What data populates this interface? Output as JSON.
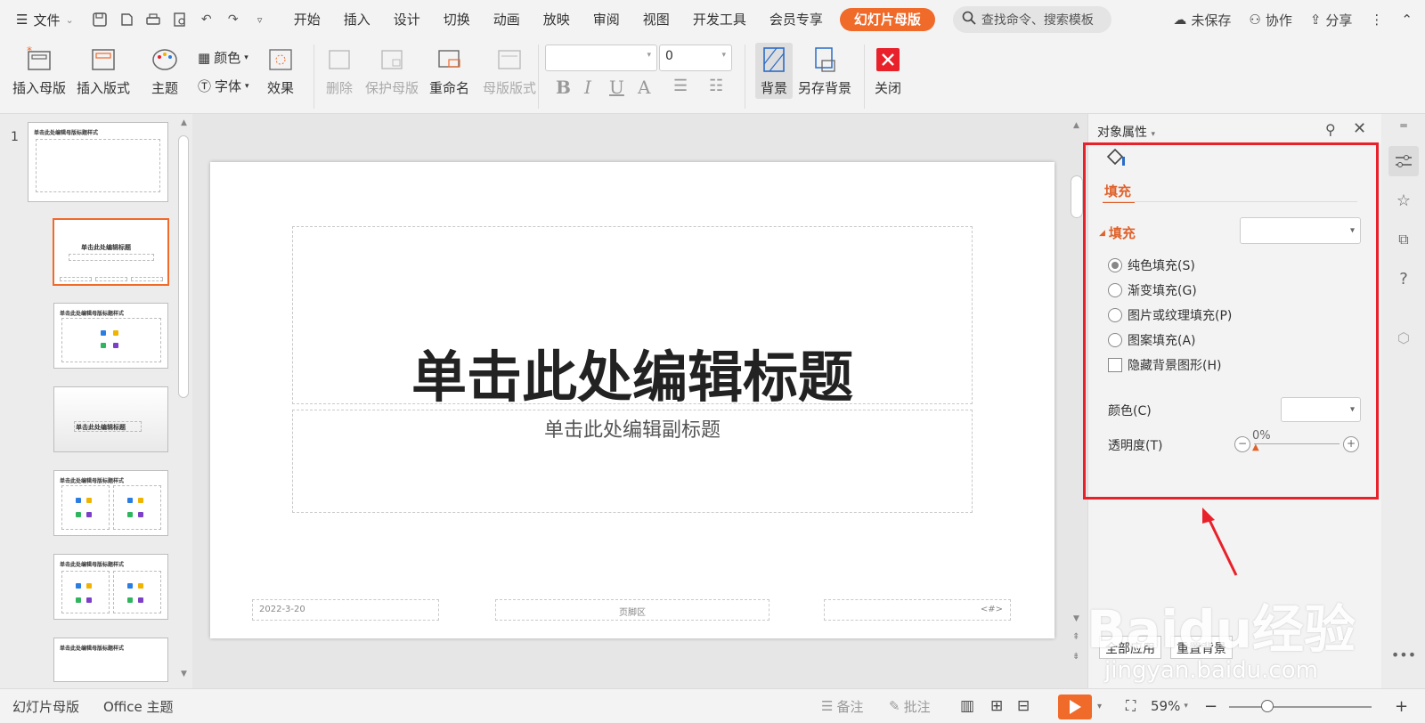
{
  "menubar": {
    "file_label": "文件",
    "tabs": [
      "开始",
      "插入",
      "设计",
      "切换",
      "动画",
      "放映",
      "审阅",
      "视图",
      "开发工具",
      "会员专享"
    ],
    "active_tab": "幻灯片母版",
    "search_placeholder": "查找命令、搜索模板",
    "unsaved": "未保存",
    "collaborate": "协作",
    "share": "分享"
  },
  "ribbon": {
    "insert_master": "插入母版",
    "insert_layout": "插入版式",
    "theme": "主题",
    "color": "颜色",
    "font": "字体",
    "effect": "效果",
    "delete": "删除",
    "protect_master": "保护母版",
    "rename": "重命名",
    "master_layout": "母版版式",
    "font_name": "",
    "font_size": "0",
    "background": "背景",
    "save_background": "另存背景",
    "close": "关闭"
  },
  "thumbnails": {
    "slide_number": "1",
    "master_title": "单击此处编辑母版标题样式",
    "layout_title": "单击此处编辑标题",
    "layout_title2": "单击此处编辑标题",
    "content_title": "单击此处编辑母版标题样式"
  },
  "slide": {
    "title": "单击此处编辑标题",
    "subtitle": "单击此处编辑副标题",
    "date": "2022-3-20",
    "footer": "页脚区",
    "page_num": "<#>"
  },
  "properties": {
    "header": "对象属性",
    "tab_fill": "填充",
    "section_fill": "填充",
    "options": [
      "纯色填充(S)",
      "渐变填充(G)",
      "图片或纹理填充(P)",
      "图案填充(A)"
    ],
    "selected_option": 0,
    "hide_bg": "隐藏背景图形(H)",
    "color_label": "颜色(C)",
    "transparency_label": "透明度(T)",
    "transparency_value": "0%",
    "apply_all": "全部应用",
    "reset_bg": "重置背景"
  },
  "status": {
    "view_name": "幻灯片母版",
    "theme_name": "Office 主题",
    "notes": "备注",
    "comments": "批注",
    "zoom": "59%"
  },
  "watermark": {
    "brand": "Baidu经验",
    "url": "jingyan.baidu.com"
  },
  "colors": {
    "accent": "#f06a2a",
    "highlight_box": "#e8212b"
  }
}
